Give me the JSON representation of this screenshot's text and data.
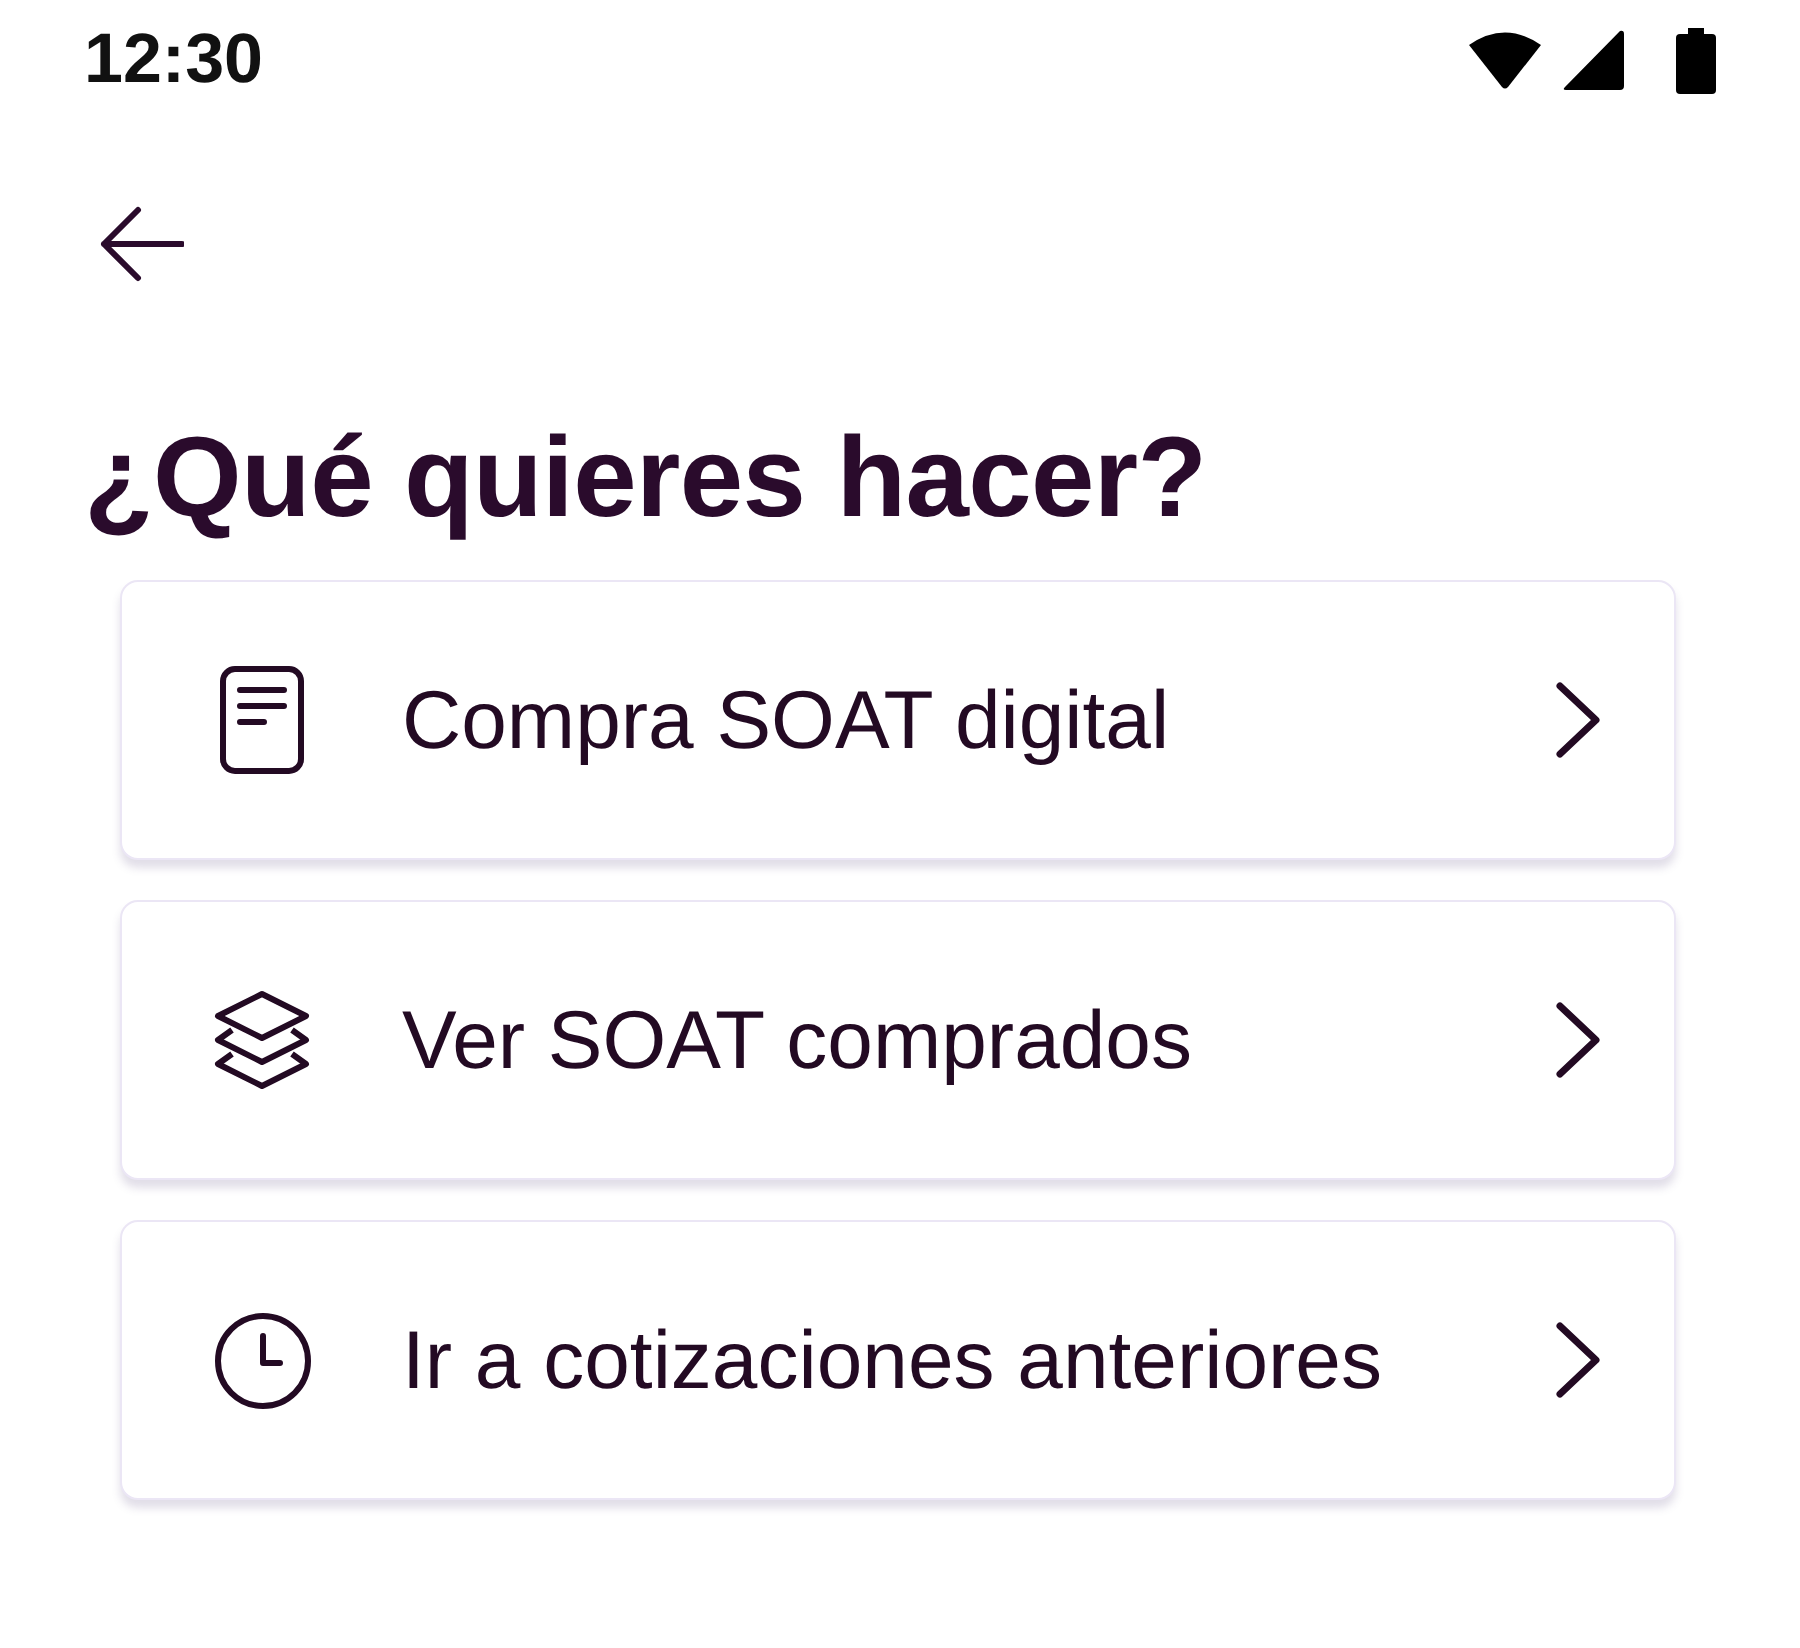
{
  "status_bar": {
    "time": "12:30"
  },
  "header": {
    "title": "¿Qué quieres hacer?"
  },
  "options": [
    {
      "label": "Compra SOAT digital"
    },
    {
      "label": "Ver SOAT comprados"
    },
    {
      "label": "Ir a cotizaciones anteriores"
    }
  ]
}
